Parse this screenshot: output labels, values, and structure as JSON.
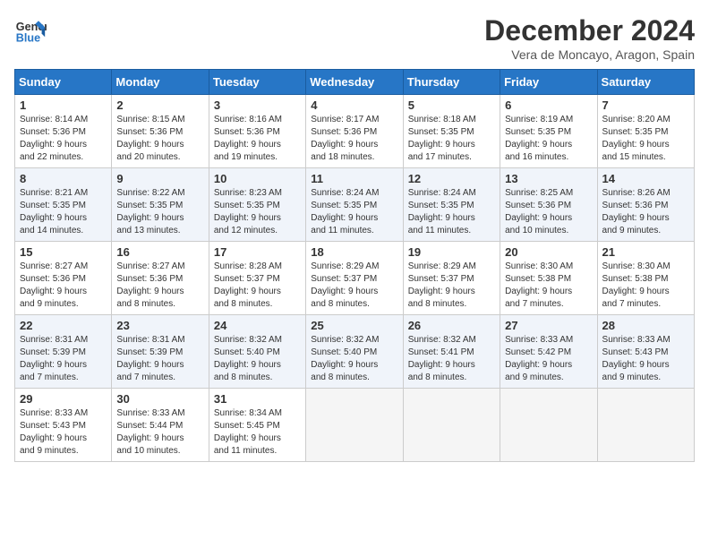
{
  "header": {
    "logo_line1": "General",
    "logo_line2": "Blue",
    "month": "December 2024",
    "location": "Vera de Moncayo, Aragon, Spain"
  },
  "columns": [
    "Sunday",
    "Monday",
    "Tuesday",
    "Wednesday",
    "Thursday",
    "Friday",
    "Saturday"
  ],
  "weeks": [
    [
      {
        "day": "1",
        "info": "Sunrise: 8:14 AM\nSunset: 5:36 PM\nDaylight: 9 hours\nand 22 minutes."
      },
      {
        "day": "2",
        "info": "Sunrise: 8:15 AM\nSunset: 5:36 PM\nDaylight: 9 hours\nand 20 minutes."
      },
      {
        "day": "3",
        "info": "Sunrise: 8:16 AM\nSunset: 5:36 PM\nDaylight: 9 hours\nand 19 minutes."
      },
      {
        "day": "4",
        "info": "Sunrise: 8:17 AM\nSunset: 5:36 PM\nDaylight: 9 hours\nand 18 minutes."
      },
      {
        "day": "5",
        "info": "Sunrise: 8:18 AM\nSunset: 5:35 PM\nDaylight: 9 hours\nand 17 minutes."
      },
      {
        "day": "6",
        "info": "Sunrise: 8:19 AM\nSunset: 5:35 PM\nDaylight: 9 hours\nand 16 minutes."
      },
      {
        "day": "7",
        "info": "Sunrise: 8:20 AM\nSunset: 5:35 PM\nDaylight: 9 hours\nand 15 minutes."
      }
    ],
    [
      {
        "day": "8",
        "info": "Sunrise: 8:21 AM\nSunset: 5:35 PM\nDaylight: 9 hours\nand 14 minutes."
      },
      {
        "day": "9",
        "info": "Sunrise: 8:22 AM\nSunset: 5:35 PM\nDaylight: 9 hours\nand 13 minutes."
      },
      {
        "day": "10",
        "info": "Sunrise: 8:23 AM\nSunset: 5:35 PM\nDaylight: 9 hours\nand 12 minutes."
      },
      {
        "day": "11",
        "info": "Sunrise: 8:24 AM\nSunset: 5:35 PM\nDaylight: 9 hours\nand 11 minutes."
      },
      {
        "day": "12",
        "info": "Sunrise: 8:24 AM\nSunset: 5:35 PM\nDaylight: 9 hours\nand 11 minutes."
      },
      {
        "day": "13",
        "info": "Sunrise: 8:25 AM\nSunset: 5:36 PM\nDaylight: 9 hours\nand 10 minutes."
      },
      {
        "day": "14",
        "info": "Sunrise: 8:26 AM\nSunset: 5:36 PM\nDaylight: 9 hours\nand 9 minutes."
      }
    ],
    [
      {
        "day": "15",
        "info": "Sunrise: 8:27 AM\nSunset: 5:36 PM\nDaylight: 9 hours\nand 9 minutes."
      },
      {
        "day": "16",
        "info": "Sunrise: 8:27 AM\nSunset: 5:36 PM\nDaylight: 9 hours\nand 8 minutes."
      },
      {
        "day": "17",
        "info": "Sunrise: 8:28 AM\nSunset: 5:37 PM\nDaylight: 9 hours\nand 8 minutes."
      },
      {
        "day": "18",
        "info": "Sunrise: 8:29 AM\nSunset: 5:37 PM\nDaylight: 9 hours\nand 8 minutes."
      },
      {
        "day": "19",
        "info": "Sunrise: 8:29 AM\nSunset: 5:37 PM\nDaylight: 9 hours\nand 8 minutes."
      },
      {
        "day": "20",
        "info": "Sunrise: 8:30 AM\nSunset: 5:38 PM\nDaylight: 9 hours\nand 7 minutes."
      },
      {
        "day": "21",
        "info": "Sunrise: 8:30 AM\nSunset: 5:38 PM\nDaylight: 9 hours\nand 7 minutes."
      }
    ],
    [
      {
        "day": "22",
        "info": "Sunrise: 8:31 AM\nSunset: 5:39 PM\nDaylight: 9 hours\nand 7 minutes."
      },
      {
        "day": "23",
        "info": "Sunrise: 8:31 AM\nSunset: 5:39 PM\nDaylight: 9 hours\nand 7 minutes."
      },
      {
        "day": "24",
        "info": "Sunrise: 8:32 AM\nSunset: 5:40 PM\nDaylight: 9 hours\nand 8 minutes."
      },
      {
        "day": "25",
        "info": "Sunrise: 8:32 AM\nSunset: 5:40 PM\nDaylight: 9 hours\nand 8 minutes."
      },
      {
        "day": "26",
        "info": "Sunrise: 8:32 AM\nSunset: 5:41 PM\nDaylight: 9 hours\nand 8 minutes."
      },
      {
        "day": "27",
        "info": "Sunrise: 8:33 AM\nSunset: 5:42 PM\nDaylight: 9 hours\nand 9 minutes."
      },
      {
        "day": "28",
        "info": "Sunrise: 8:33 AM\nSunset: 5:43 PM\nDaylight: 9 hours\nand 9 minutes."
      }
    ],
    [
      {
        "day": "29",
        "info": "Sunrise: 8:33 AM\nSunset: 5:43 PM\nDaylight: 9 hours\nand 9 minutes."
      },
      {
        "day": "30",
        "info": "Sunrise: 8:33 AM\nSunset: 5:44 PM\nDaylight: 9 hours\nand 10 minutes."
      },
      {
        "day": "31",
        "info": "Sunrise: 8:34 AM\nSunset: 5:45 PM\nDaylight: 9 hours\nand 11 minutes."
      },
      null,
      null,
      null,
      null
    ]
  ]
}
